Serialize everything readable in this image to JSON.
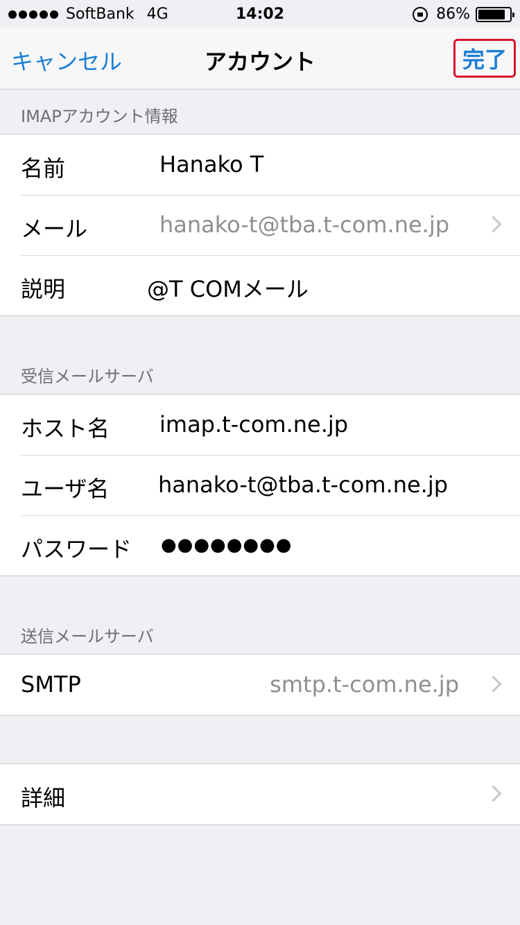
{
  "status_bar": {
    "carrier": "SoftBank",
    "network": "4G",
    "time": "14:02",
    "battery": "86%",
    "battery_level": 0.86,
    "signal_bars": 5
  },
  "nav": {
    "cancel_label": "キャンセル",
    "title": "アカウント",
    "done_label": "完了"
  },
  "sections": {
    "imap_header": "IMAPアカウント情報",
    "incoming_header": "受信メールサーバ",
    "outgoing_header": "送信メールサーバ"
  },
  "imap": {
    "name_label": "名前",
    "name_value": "Hanako T",
    "mail_label": "メール",
    "mail_value": "hanako-t@tba.t-com.ne.jp",
    "desc_label": "説明",
    "desc_value": "@T COMメール"
  },
  "incoming": {
    "host_label": "ホスト名",
    "host_value": "imap.t-com.ne.jp",
    "user_label": "ユーザ名",
    "user_value": "hanako-t@tba.t-com.ne.jp",
    "password_label": "パスワード",
    "password_value": "●●●●●●●●"
  },
  "outgoing": {
    "smtp_label": "SMTP",
    "smtp_value": "smtp.t-com.ne.jp"
  },
  "advanced": {
    "label": "詳細"
  },
  "colors": {
    "accent": "#1a7fd4",
    "highlight": "#d7152a",
    "background": "#efeff4"
  }
}
